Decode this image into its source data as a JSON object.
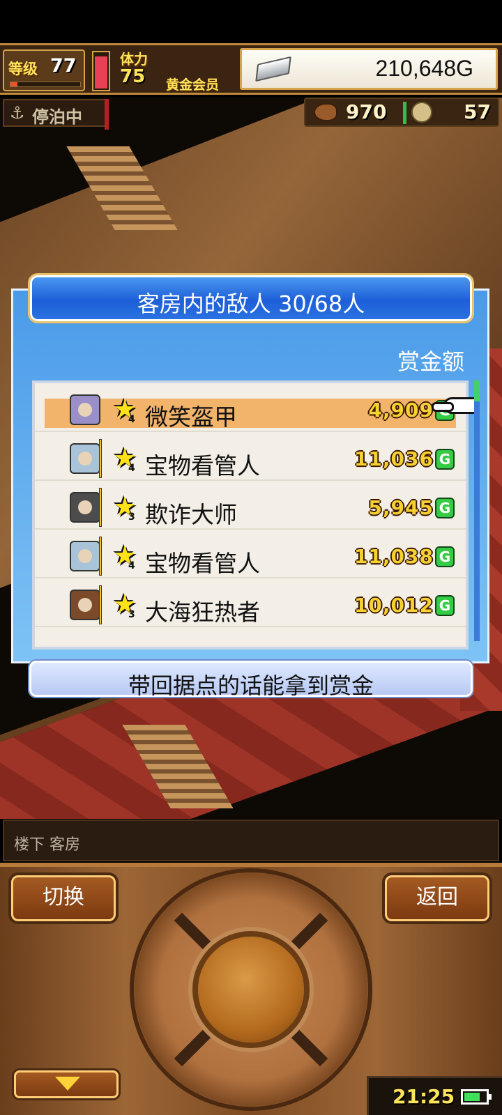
{
  "hud": {
    "level_label": "等级",
    "level_value": "77",
    "level_progress": 0.1,
    "stamina_label": "体力",
    "stamina_value": "75",
    "stamina_level": 0.85,
    "member_label": "黄金会员",
    "gold_value": "210,648G"
  },
  "status": {
    "docked_label": "停泊中",
    "anchor_icon": "anchor-icon",
    "food_value": "970",
    "coin_value": "57"
  },
  "panel": {
    "title": "客房内的敌人  30/68人",
    "column_header": "赏金额",
    "enemies": [
      {
        "name": "微笑盔甲",
        "rank": "4",
        "bounty": "4,909",
        "currency": "G",
        "selected": true
      },
      {
        "name": "宝物看管人",
        "rank": "4",
        "bounty": "11,036",
        "currency": "G",
        "selected": false
      },
      {
        "name": "欺诈大师",
        "rank": "3",
        "bounty": "5,945",
        "currency": "G",
        "selected": false
      },
      {
        "name": "宝物看管人",
        "rank": "4",
        "bounty": "11,038",
        "currency": "G",
        "selected": false
      },
      {
        "name": "大海狂热者",
        "rank": "3",
        "bounty": "10,012",
        "currency": "G",
        "selected": false
      }
    ],
    "hint": "带回据点的话能拿到赏金"
  },
  "location": "楼下 客房",
  "controls": {
    "switch_label": "切换",
    "back_label": "返回"
  },
  "clock": "21:25",
  "battery_level": 0.7,
  "colors": {
    "title_blue": "#1d5fd8",
    "selected_row": "#f2b36a",
    "bounty_gold": "#f4d233",
    "gold_badge": "#33cc44"
  }
}
